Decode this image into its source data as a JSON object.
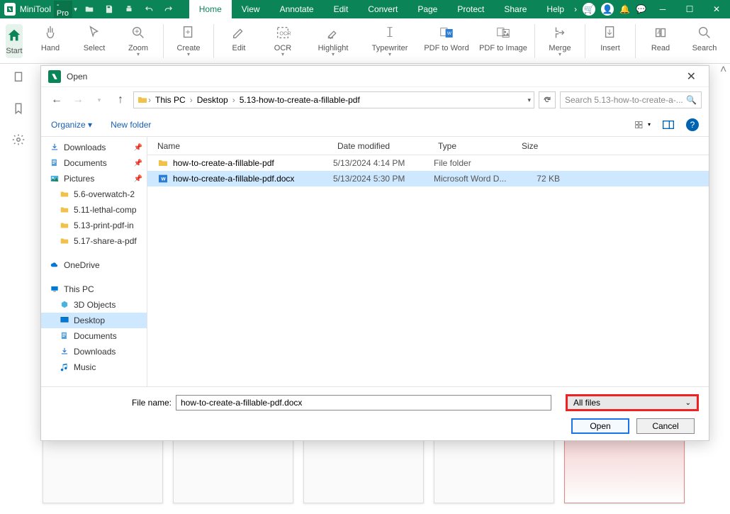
{
  "app": {
    "name": "MiniTool",
    "suffix": "-Pro"
  },
  "menu": [
    "Home",
    "View",
    "Annotate",
    "Edit",
    "Convert",
    "Page",
    "Protect",
    "Share",
    "Help"
  ],
  "menu_active": 0,
  "ribbon": {
    "start": "Start",
    "items": [
      "Hand",
      "Select",
      "Zoom",
      "Create",
      "Edit",
      "OCR",
      "Highlight",
      "Typewriter",
      "PDF to Word",
      "PDF to Image",
      "Merge",
      "Insert",
      "Read",
      "Search"
    ]
  },
  "dialog": {
    "title": "Open",
    "breadcrumb": [
      "This PC",
      "Desktop",
      "5.13-how-to-create-a-fillable-pdf"
    ],
    "search_placeholder": "Search 5.13-how-to-create-a-...",
    "organize": "Organize",
    "new_folder": "New folder",
    "tree": [
      {
        "label": "Downloads",
        "icon": "download",
        "pin": true
      },
      {
        "label": "Documents",
        "icon": "doc",
        "pin": true
      },
      {
        "label": "Pictures",
        "icon": "pic",
        "pin": true
      },
      {
        "label": "5.6-overwatch-2",
        "icon": "folder",
        "indent": 1
      },
      {
        "label": "5.11-lethal-comp",
        "icon": "folder",
        "indent": 1
      },
      {
        "label": "5.13-print-pdf-in",
        "icon": "folder",
        "indent": 1
      },
      {
        "label": "5.17-share-a-pdf",
        "icon": "folder",
        "indent": 1
      },
      {
        "gap": true
      },
      {
        "label": "OneDrive",
        "icon": "cloud"
      },
      {
        "gap": true
      },
      {
        "label": "This PC",
        "icon": "pc"
      },
      {
        "label": "3D Objects",
        "icon": "3d",
        "indent": 2
      },
      {
        "label": "Desktop",
        "icon": "desktop",
        "indent": 2,
        "selected": true
      },
      {
        "label": "Documents",
        "icon": "doc",
        "indent": 2
      },
      {
        "label": "Downloads",
        "icon": "download",
        "indent": 2
      },
      {
        "label": "Music",
        "icon": "music",
        "indent": 2
      }
    ],
    "columns": [
      "Name",
      "Date modified",
      "Type",
      "Size"
    ],
    "files": [
      {
        "name": "how-to-create-a-fillable-pdf",
        "date": "5/13/2024 4:14 PM",
        "type": "File folder",
        "size": "",
        "icon": "folder"
      },
      {
        "name": "how-to-create-a-fillable-pdf.docx",
        "date": "5/13/2024 5:30 PM",
        "type": "Microsoft Word D...",
        "size": "72 KB",
        "icon": "word",
        "selected": true
      }
    ],
    "file_name_label": "File name:",
    "file_name_value": "how-to-create-a-fillable-pdf.docx",
    "filter": "All files",
    "open_btn": "Open",
    "cancel_btn": "Cancel"
  }
}
